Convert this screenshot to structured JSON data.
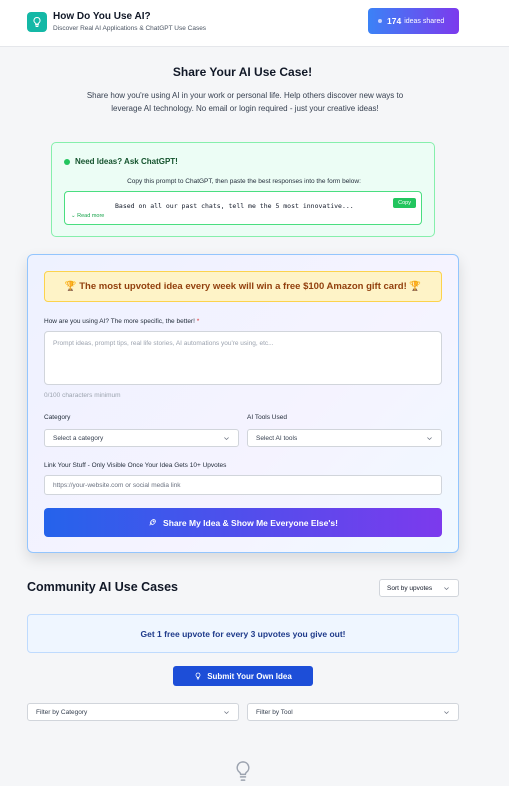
{
  "header": {
    "title": "How Do You Use AI?",
    "subtitle": "Discover Real AI Applications & ChatGPT Use Cases",
    "badge_count": "174",
    "badge_label": "ideas shared",
    "logo_icon": "lightbulb-icon"
  },
  "intro": {
    "title": "Share Your AI Use Case!",
    "description": "Share how you're using AI in your work or personal life. Help others discover new ways to leverage AI technology. No email or login required - just your creative ideas!"
  },
  "chatgpt_box": {
    "heading": "Need Ideas? Ask ChatGPT!",
    "instructions": "Copy this prompt to ChatGPT, then paste the best responses into the form below:",
    "prompt_text": "Based on all our past chats, tell me the 5 most innovative...",
    "copy_label": "Copy",
    "read_more_label": "Read more"
  },
  "form": {
    "gift_banner": "🏆 The most upvoted idea every week will win a free $100 Amazon gift card! 🏆",
    "usage_label": "How are you using AI? The more specific, the better!",
    "required_mark": "*",
    "usage_placeholder": "Prompt ideas, prompt tips, real life stories, AI automations you're using, etc...",
    "char_count": "0/100 characters minimum",
    "category_label": "Category",
    "category_value": "Select a category",
    "tools_label": "AI Tools Used",
    "tools_value": "Select AI tools",
    "link_label": "Link Your Stuff - Only Visible Once Your Idea Gets 10+ Upvotes",
    "link_placeholder": "https://your-website.com or social media link",
    "submit_label": "Share My Idea & Show Me Everyone Else's!"
  },
  "community": {
    "title": "Community AI Use Cases",
    "sort_value": "Sort by upvotes",
    "promo": "Get 1 free upvote for every 3 upvotes you give out!",
    "submit_own_label": "Submit Your Own Idea",
    "filter_category": "Filter by Category",
    "filter_tool": "Filter by Tool"
  },
  "colors": {
    "accent_gradient_start": "#2563eb",
    "accent_gradient_end": "#7c3aed",
    "logo_teal": "#14b8a6",
    "success_green": "#22c55e"
  }
}
